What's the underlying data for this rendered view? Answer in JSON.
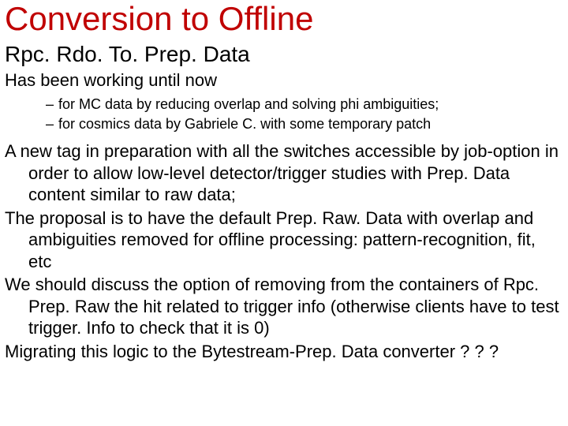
{
  "title": "Conversion to Offline",
  "subtitle": "Rpc. Rdo. To. Prep. Data",
  "working_line": "Has been working until now",
  "sub_bullets": [
    "for MC data by reducing overlap and solving phi ambiguities;",
    "for cosmics data by Gabriele C. with some temporary patch"
  ],
  "paragraphs": [
    "A new tag in preparation with all the switches accessible by job-option in order to allow low-level detector/trigger studies with Prep. Data content similar to raw data;",
    "The proposal is to have the default Prep. Raw. Data with overlap and ambiguities removed for offline processing: pattern-recognition, fit, etc",
    "We should discuss the option of removing from the containers of Rpc. Prep. Raw the hit related to trigger info (otherwise clients have to test trigger. Info to check that it is 0)",
    "Migrating this logic to the Bytestream-Prep. Data converter ? ? ?"
  ]
}
